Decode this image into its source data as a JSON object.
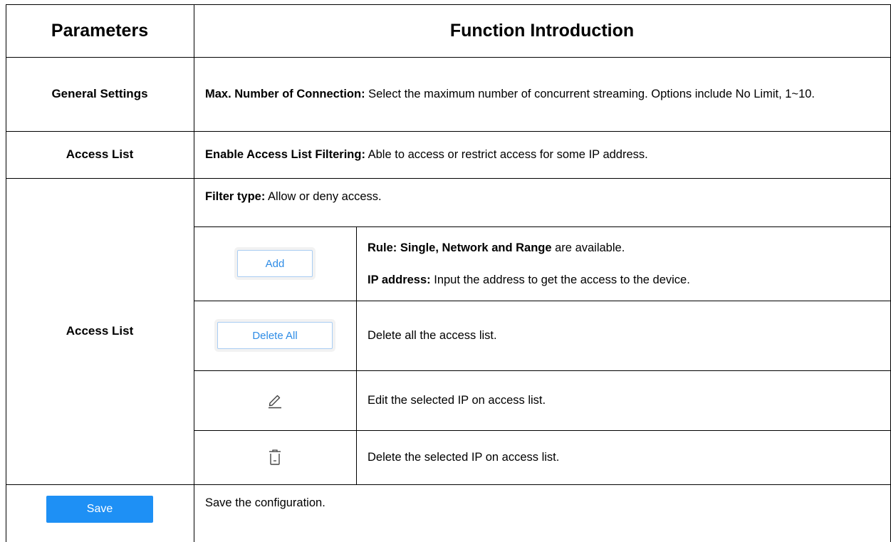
{
  "header": {
    "col1": "Parameters",
    "col2": "Function Introduction"
  },
  "rows": {
    "general": {
      "param": "General Settings",
      "desc_bold": "Max. Number of Connection:",
      "desc_text": " Select the maximum number of concurrent streaming. Options include No Limit, 1~10."
    },
    "access1": {
      "param": "Access List",
      "desc_bold": "Enable Access List Filtering:",
      "desc_text": " Able to access or restrict access for some IP address."
    },
    "access2": {
      "param": "Access List",
      "filter_bold": "Filter type:",
      "filter_text": " Allow or deny access.",
      "add_label": "Add",
      "rule_bold": "Rule: Single, Network and Range",
      "rule_text": " are available.",
      "ip_bold": "IP address:",
      "ip_text": " Input the address to get the access to the device.",
      "delete_all_label": "Delete All",
      "delete_all_desc": "Delete all the access list.",
      "edit_desc": "Edit the selected IP on access list.",
      "delete_desc": "Delete the selected IP on access list."
    },
    "save": {
      "save_label": "Save",
      "desc": "Save the configuration."
    }
  },
  "icons": {
    "edit": "pencil-icon",
    "delete": "trash-icon"
  },
  "colors": {
    "button_blue": "#1e90f5",
    "button_text_blue": "#2e8ce6"
  }
}
